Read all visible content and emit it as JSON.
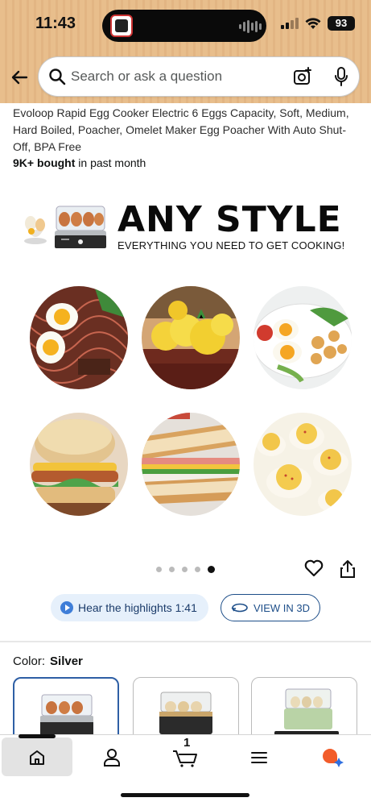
{
  "status_bar": {
    "time": "11:43",
    "battery": "93"
  },
  "search": {
    "placeholder": "Search or ask a question"
  },
  "product": {
    "title": "Evoloop Rapid Egg Cooker Electric 6 Eggs Capacity, Soft, Medium, Hard Boiled, Poacher, Omelet Maker Egg Poacher With Auto Shut-Off, BPA Free",
    "bought_count": "9K+ bought",
    "bought_suffix": "in past month"
  },
  "hero_image": {
    "headline": "ANY STYLE",
    "subline": "EVERYTHING YOU NEED TO GET COOKING!",
    "foods": [
      "noodle-bowl",
      "scrambled-eggs-toast",
      "pasta-salad",
      "breakfast-sandwich",
      "club-sandwich",
      "deviled-eggs"
    ]
  },
  "carousel": {
    "total": 5,
    "active": 4
  },
  "actions": {
    "hear_highlights": "Hear the highlights 1:41",
    "view_3d": "VIEW IN 3D"
  },
  "color": {
    "label": "Color:",
    "value": "Silver"
  },
  "swatches": [
    "Silver",
    "Black",
    "Green"
  ],
  "nav": {
    "cart_count": "1"
  },
  "colors": {
    "header_tan": "#e8be8c",
    "accent_blue": "#1d4e89",
    "selected_border": "#2e5fa5"
  }
}
